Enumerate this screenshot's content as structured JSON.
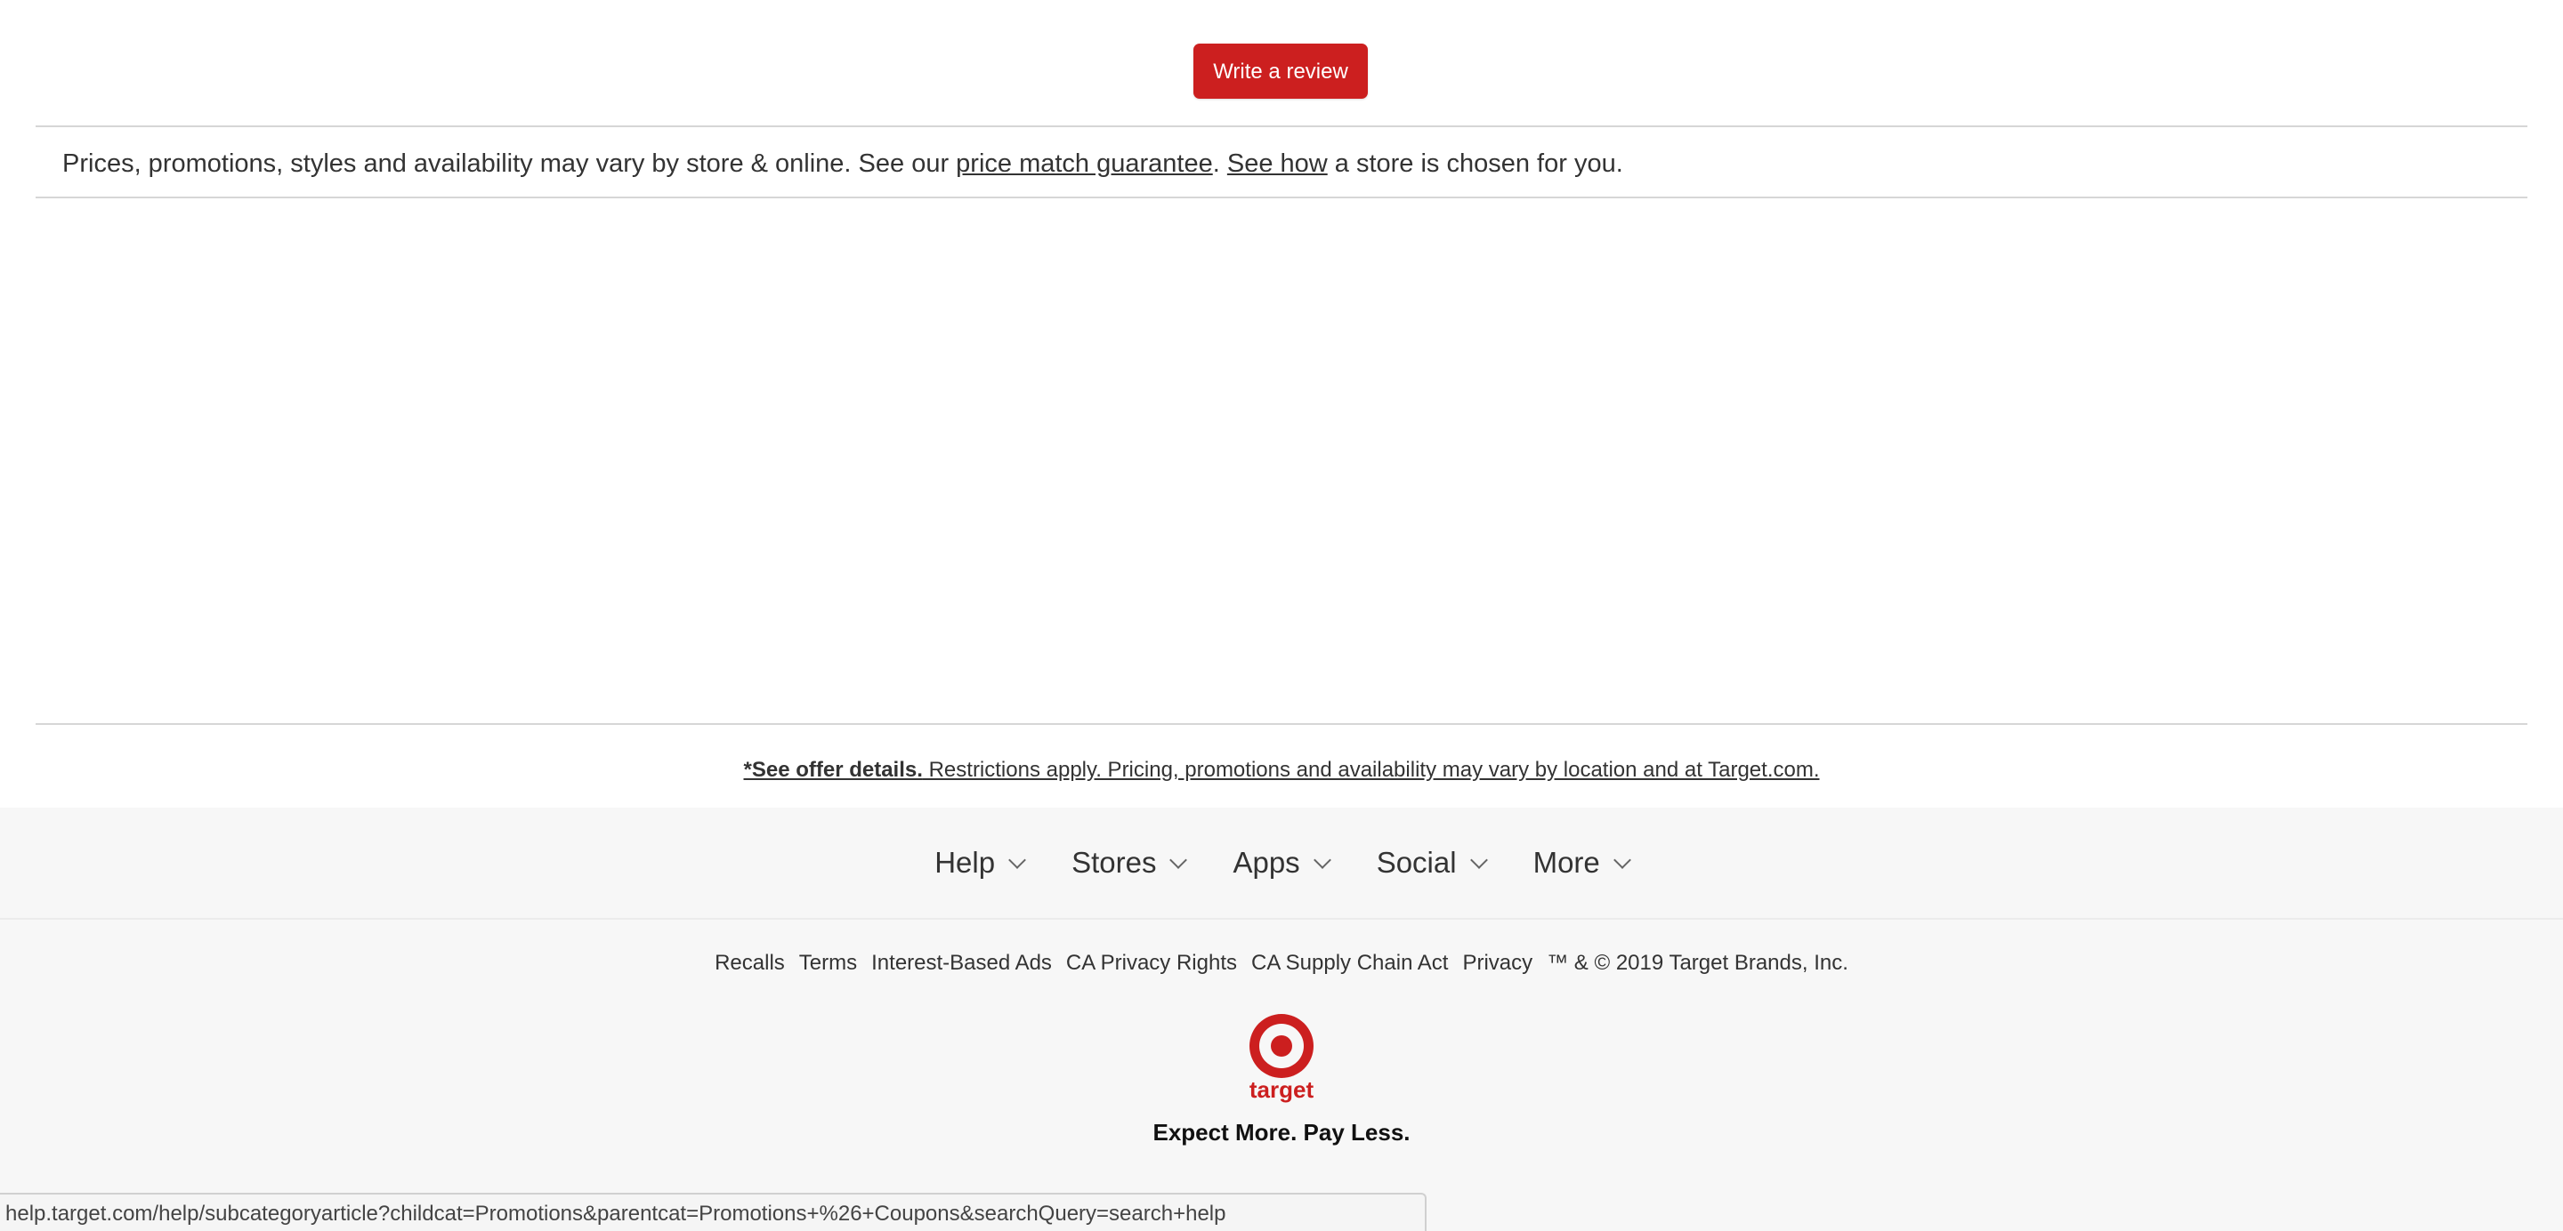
{
  "review": {
    "button_label": "Write a review"
  },
  "disclaimer": {
    "text_before": "Prices, promotions, styles and availability may vary by store & online. See our ",
    "price_match_link": "price match guarantee",
    "text_middle": ". ",
    "see_how_link": "See how",
    "text_after": " a store is chosen for you."
  },
  "offer": {
    "bold_label": "*See offer details.",
    "text": " Restrictions apply. Pricing, promotions and availability may vary by location and at Target.com."
  },
  "footer": {
    "nav": {
      "help": "Help",
      "stores": "Stores",
      "apps": "Apps",
      "social": "Social",
      "more": "More"
    },
    "legal": {
      "recalls": "Recalls",
      "terms": "Terms",
      "interest_ads": "Interest-Based Ads",
      "ca_privacy": "CA Privacy Rights",
      "ca_supply": "CA Supply Chain Act",
      "privacy": "Privacy",
      "copyright": "™ & © 2019 Target Brands, Inc."
    },
    "logo_text": "target",
    "tagline": "Expect More. Pay Less."
  },
  "status_bar": {
    "url": "help.target.com/help/subcategoryarticle?childcat=Promotions&parentcat=Promotions+%26+Coupons&searchQuery=search+help"
  },
  "colors": {
    "brand_red": "#cc1f1f",
    "footer_bg": "#f7f7f7",
    "divider": "#d6d6d6"
  }
}
